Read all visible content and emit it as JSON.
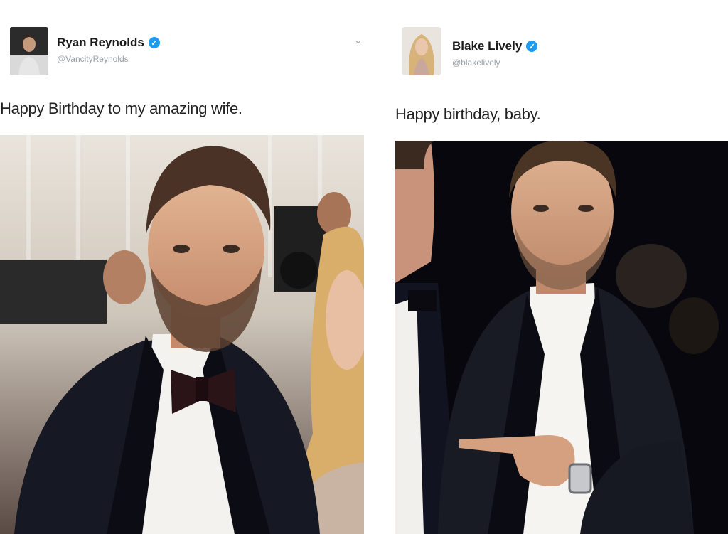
{
  "tweets": [
    {
      "name": "Ryan Reynolds",
      "handle": "@VancityReynolds",
      "text": "Happy Birthday to my amazing wife.",
      "verified": true,
      "avatar_icon": "person-avatar",
      "photo_icon": "tuxedo-man-photo"
    },
    {
      "name": "Blake Lively",
      "handle": "@blakelively",
      "text": "Happy birthday, baby.",
      "verified": true,
      "avatar_icon": "person-avatar",
      "photo_icon": "tuxedo-man-pointing-photo"
    }
  ],
  "ui": {
    "verified_glyph": "✓",
    "chevron_glyph": "⌄"
  },
  "colors": {
    "verified_blue": "#1d9bf0",
    "name_text": "#1a1a1a",
    "handle_text": "#9aa0a6"
  }
}
